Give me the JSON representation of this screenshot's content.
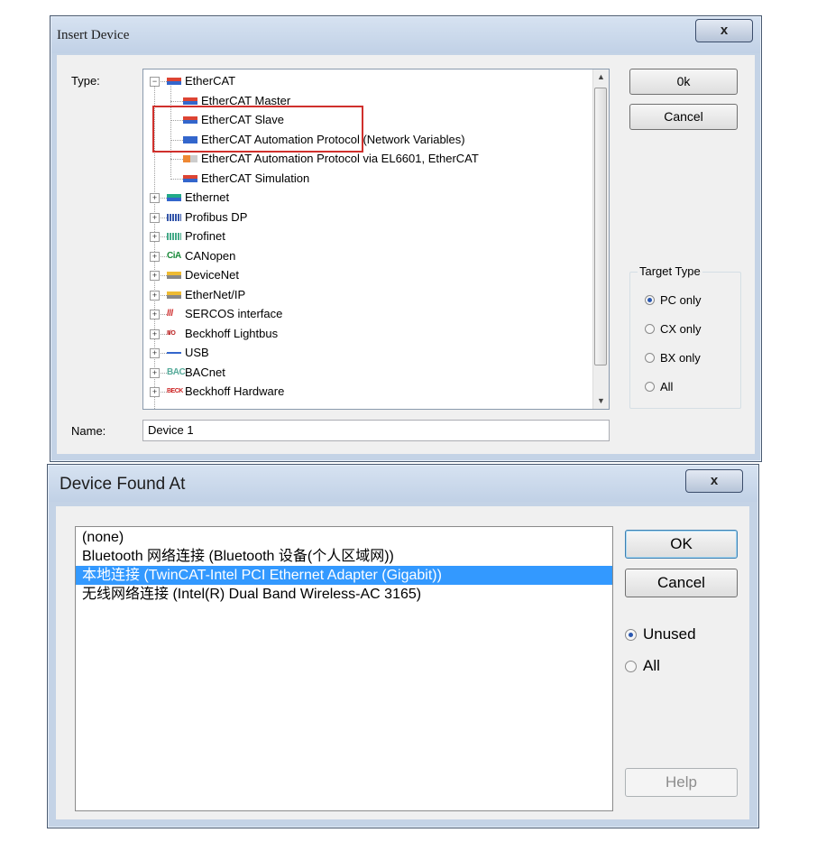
{
  "insert_device": {
    "title": "Insert Device",
    "close_glyph": "x",
    "type_label": "Type:",
    "name_label": "Name:",
    "name_value": "Device 1",
    "ok_label": "0k",
    "cancel_label": "Cancel",
    "target_type": {
      "legend": "Target Type",
      "options": [
        {
          "label": "PC only",
          "selected": true
        },
        {
          "label": "CX only",
          "selected": false
        },
        {
          "label": "BX only",
          "selected": false
        },
        {
          "label": "All",
          "selected": false
        }
      ]
    },
    "tree": [
      {
        "label": "EtherCAT",
        "icon": "ethercat-icon",
        "level": 0,
        "expander": "−"
      },
      {
        "label": "EtherCAT Master",
        "icon": "ethercat-master-icon",
        "level": 1
      },
      {
        "label": "EtherCAT Slave",
        "icon": "ethercat-slave-icon",
        "level": 1
      },
      {
        "label": "EtherCAT Automation Protocol (Network Variables)",
        "icon": "ethercat-eap-icon",
        "level": 1
      },
      {
        "label": "EtherCAT Automation Protocol via EL6601, EtherCAT",
        "icon": "el6601-icon",
        "level": 1
      },
      {
        "label": "EtherCAT Simulation",
        "icon": "ethercat-sim-icon",
        "level": 1
      },
      {
        "label": "Ethernet",
        "icon": "ethernet-icon",
        "level": 0,
        "expander": "+"
      },
      {
        "label": "Profibus DP",
        "icon": "profibus-icon",
        "level": 0,
        "expander": "+"
      },
      {
        "label": "Profinet",
        "icon": "profinet-icon",
        "level": 0,
        "expander": "+"
      },
      {
        "label": "CANopen",
        "icon": "canopen-icon",
        "level": 0,
        "expander": "+",
        "icon_text": "CiA"
      },
      {
        "label": "DeviceNet",
        "icon": "devicenet-icon",
        "level": 0,
        "expander": "+"
      },
      {
        "label": "EtherNet/IP",
        "icon": "ethernet-ip-icon",
        "level": 0,
        "expander": "+"
      },
      {
        "label": "SERCOS interface",
        "icon": "sercos-icon",
        "level": 0,
        "expander": "+",
        "icon_text": "///"
      },
      {
        "label": "Beckhoff Lightbus",
        "icon": "lightbus-icon",
        "level": 0,
        "expander": "+",
        "icon_text": "II/O"
      },
      {
        "label": "USB",
        "icon": "usb-icon",
        "level": 0,
        "expander": "+"
      },
      {
        "label": "BACnet",
        "icon": "bacnet-icon",
        "level": 0,
        "expander": "+",
        "icon_text": "BAC"
      },
      {
        "label": "Beckhoff Hardware",
        "icon": "beckhoff-icon",
        "level": 0,
        "expander": "+",
        "icon_text": "BECK"
      }
    ],
    "highlight_color": "#d0302c"
  },
  "device_found": {
    "title": "Device Found At",
    "close_glyph": "x",
    "items": [
      {
        "label": "(none)",
        "selected": false
      },
      {
        "label": "Bluetooth 网络连接 (Bluetooth 设备(个人区域网))",
        "selected": false
      },
      {
        "label": "本地连接 (TwinCAT-Intel PCI Ethernet Adapter (Gigabit))",
        "selected": true
      },
      {
        "label": "无线网络连接 (Intel(R) Dual Band Wireless-AC 3165)",
        "selected": false
      }
    ],
    "ok_label": "OK",
    "cancel_label": "Cancel",
    "help_label": "Help",
    "filter_options": [
      {
        "label": "Unused",
        "selected": true
      },
      {
        "label": "All",
        "selected": false
      }
    ],
    "selection_color": "#3399ff"
  }
}
